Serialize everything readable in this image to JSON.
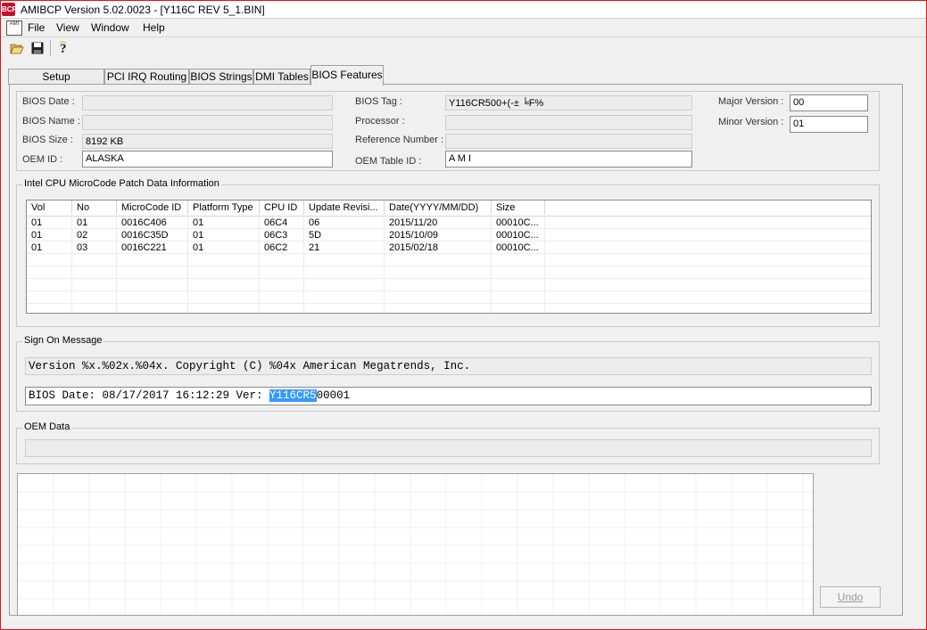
{
  "window": {
    "title": "AMIBCP Version 5.02.0023 - [Y116C REV 5_1.BIN]",
    "app_icon_text": "BCP"
  },
  "menu": {
    "icon_text": "AMI",
    "items": [
      "File",
      "View",
      "Window",
      "Help"
    ]
  },
  "toolbar": {
    "buttons": [
      "open-icon",
      "save-icon",
      "help-icon"
    ]
  },
  "tabs": [
    {
      "label": "Setup Configuration",
      "active": false
    },
    {
      "label": "PCI IRQ Routing",
      "active": false
    },
    {
      "label": "BIOS Strings",
      "active": false
    },
    {
      "label": "DMI Tables",
      "active": false
    },
    {
      "label": "BIOS Features",
      "active": true
    }
  ],
  "bios_info": {
    "bios_date_label": "BIOS Date :",
    "bios_date": "",
    "bios_name_label": "BIOS Name :",
    "bios_name": "",
    "bios_size_label": "BIOS Size :",
    "bios_size": "8192 KB",
    "oem_id_label": "OEM ID :",
    "oem_id": "ALASKA",
    "bios_tag_label": "BIOS Tag :",
    "bios_tag": "Y116CR500+(-± ╘F%",
    "processor_label": "Processor :",
    "processor": "",
    "reference_number_label": "Reference Number :",
    "reference_number": "",
    "oem_table_id_label": "OEM Table ID :",
    "oem_table_id": "A M I",
    "major_version_label": "Major Version :",
    "major_version": "00",
    "minor_version_label": "Minor Version :",
    "minor_version": "01"
  },
  "microcode": {
    "title": "Intel CPU MicroCode Patch Data Information",
    "columns": [
      "Vol",
      "No",
      "MicroCode ID",
      "Platform Type",
      "CPU ID",
      "Update Revisi...",
      "Date(YYYY/MM/DD)",
      "Size"
    ],
    "rows": [
      [
        "01",
        "01",
        "0016C406",
        "01",
        "06C4",
        "06",
        "2015/11/20",
        "00010C..."
      ],
      [
        "01",
        "02",
        "0016C35D",
        "01",
        "06C3",
        "5D",
        "2015/10/09",
        "00010C..."
      ],
      [
        "01",
        "03",
        "0016C221",
        "01",
        "06C2",
        "21",
        "2015/02/18",
        "00010C..."
      ]
    ]
  },
  "sign_on": {
    "title": "Sign On Message",
    "line1": "Version %x.%02x.%04x. Copyright (C) %04x American Megatrends, Inc.",
    "line2_prefix": "BIOS Date: 08/17/2017 16:12:29 Ver: ",
    "line2_selected": "Y116CR5",
    "line2_suffix": "00001"
  },
  "oem_data": {
    "title": "OEM Data",
    "value": ""
  },
  "undo": {
    "label": "Undo"
  }
}
